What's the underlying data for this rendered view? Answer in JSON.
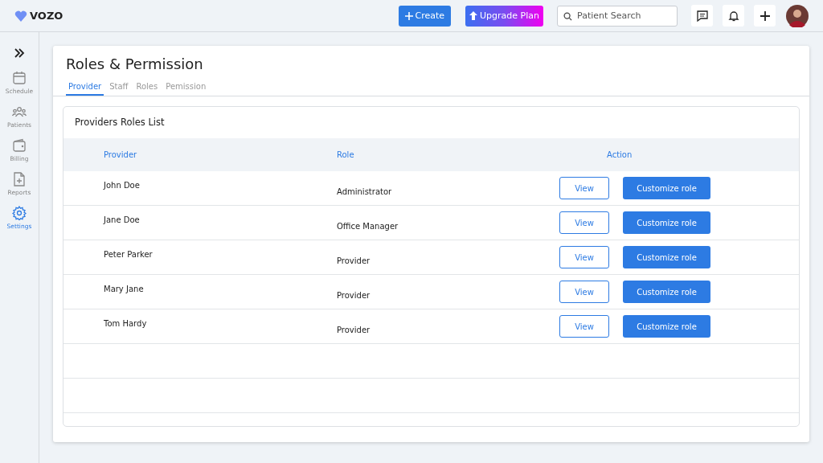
{
  "brand": {
    "name": "VOZO"
  },
  "topbar": {
    "create_button": "Create",
    "upgrade_button": "Upgrade Plan",
    "search": {
      "placeholder": "Patient Search"
    }
  },
  "sidebar": {
    "items": [
      {
        "label": "Schedule",
        "kind": "calendar",
        "selected": false
      },
      {
        "label": "Patients",
        "kind": "people",
        "selected": false
      },
      {
        "label": "Billing",
        "kind": "wallet",
        "selected": false
      },
      {
        "label": "Reports",
        "kind": "report",
        "selected": false
      },
      {
        "label": "Settings",
        "kind": "gear",
        "selected": true
      }
    ]
  },
  "page": {
    "title": "Roles & Permission",
    "tabs": [
      {
        "label": "Provider",
        "selected": true
      },
      {
        "label": "Staff",
        "selected": false
      },
      {
        "label": "Roles",
        "selected": false
      },
      {
        "label": "Pemission",
        "selected": false
      }
    ]
  },
  "table": {
    "title": "Providers Roles List",
    "columns": [
      "Provider",
      "Role",
      "Action"
    ],
    "rows": [
      {
        "provider": "John Doe",
        "role": "Administrator",
        "view": "View",
        "customize": "Customize role"
      },
      {
        "provider": "Jane Doe",
        "role": "Office Manager",
        "view": "View",
        "customize": "Customize role"
      },
      {
        "provider": "Peter Parker",
        "role": "Provider",
        "view": "View",
        "customize": "Customize role"
      },
      {
        "provider": "Mary Jane",
        "role": "Provider",
        "view": "View",
        "customize": "Customize role"
      },
      {
        "provider": "Tom Hardy",
        "role": "Provider",
        "view": "View",
        "customize": "Customize role"
      }
    ]
  }
}
